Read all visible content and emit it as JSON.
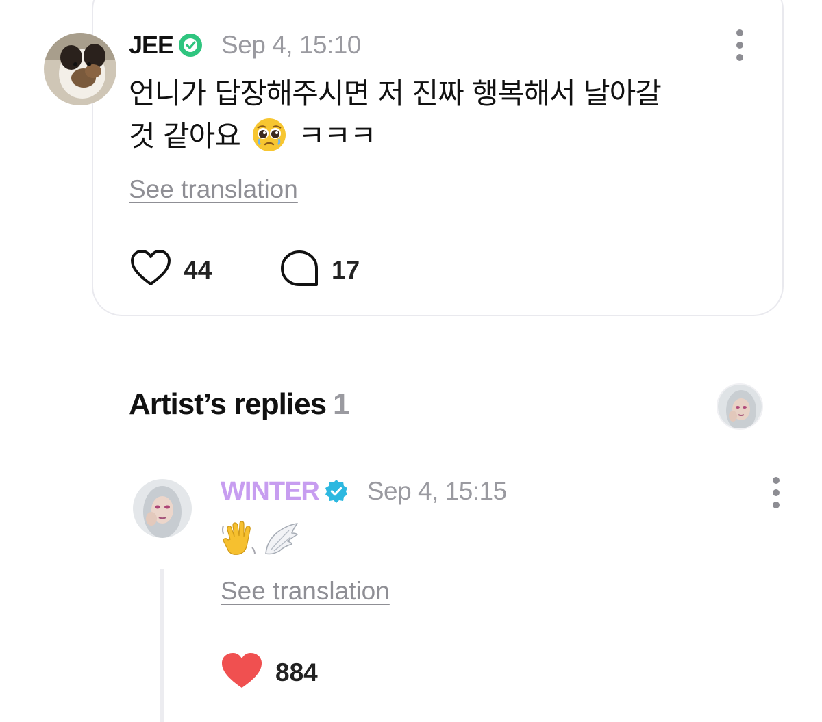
{
  "comment": {
    "user_name": "JEE",
    "timestamp": "Sep 4, 15:10",
    "text_line1": "언니가 답장해주시면 저 진짜 행복해서 날아갈",
    "text_line2_prefix": "것 같아요",
    "text_line2_suffix": "ㅋㅋㅋ",
    "see_translation": "See translation",
    "likes": "44",
    "replies": "17",
    "badge_color": "#2fc57f"
  },
  "artist_replies": {
    "title": "Artist’s replies",
    "count": "1"
  },
  "reply": {
    "user_name": "WINTER",
    "timestamp": "Sep 4, 15:15",
    "see_translation": "See translation",
    "likes": "884",
    "name_color": "#c79df0",
    "badge_color": "#2db8e0",
    "heart_color": "#f05050",
    "emojis": [
      "waving-hand-emoji",
      "wing-emoji"
    ]
  }
}
